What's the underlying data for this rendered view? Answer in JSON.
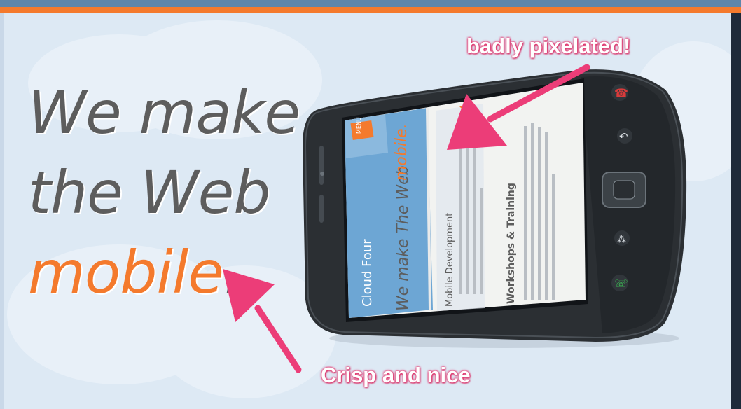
{
  "headline": {
    "line1": "We make",
    "line2": "the Web",
    "accent_word": "mobile",
    "accent_punct": "."
  },
  "annotations": {
    "top": "badly pixelated!",
    "bottom": "Crisp and nice"
  },
  "phone_screen": {
    "brand": "Cloud Four",
    "tagline_main": "We make The Web",
    "tagline_accent": "mobile.",
    "section1_title": "Mobile Development",
    "section2_title": "Workshops & Training"
  },
  "colors": {
    "accent_orange": "#f47a2d",
    "header_blue": "#5e86ab",
    "callout_pink": "#e8336d",
    "headline_gray": "#5d5d5d"
  }
}
